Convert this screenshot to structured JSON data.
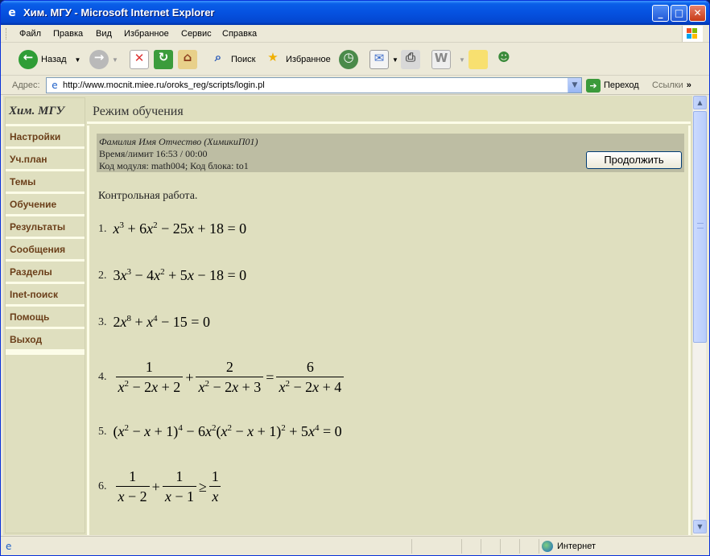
{
  "window": {
    "title": "Хим. МГУ - Microsoft Internet Explorer",
    "minimize": "_",
    "maximize": "□",
    "close": "✕"
  },
  "menu": [
    "Файл",
    "Правка",
    "Вид",
    "Избранное",
    "Сервис",
    "Справка"
  ],
  "toolbar": {
    "back": "Назад",
    "search": "Поиск",
    "favorites": "Избранное"
  },
  "address": {
    "label": "Адрес:",
    "url": "http://www.mocnit.miee.ru/oroks_reg/scripts/login.pl",
    "go": "Переход",
    "links": "Ссылки"
  },
  "sidebar": {
    "title": "Хим. МГУ",
    "items": [
      "Настройки",
      "Уч.план",
      "Темы",
      "Обучение",
      "Результаты",
      "Сообщения",
      "Разделы",
      "Inet-поиск",
      "Помощь",
      "Выход"
    ]
  },
  "main": {
    "header": "Режим обучения",
    "student": "Фамилия Имя Отчество (ХимикиП01)",
    "time": "Время/лимит 16:53 / 00:00",
    "module": "Код модуля: math004; Код блока: to1",
    "continue_label": "Продолжить",
    "intro": "Контрольная работа.",
    "problem_numbers": [
      "1.",
      "2.",
      "3.",
      "4.",
      "5.",
      "6."
    ]
  },
  "status": {
    "zone": "Интернет"
  },
  "colors": {
    "content_bg": "#dfdfbf",
    "nav_text": "#6b3f1a",
    "infobox_bg": "#bdbda3",
    "titlebar": "#0a5fe8"
  }
}
